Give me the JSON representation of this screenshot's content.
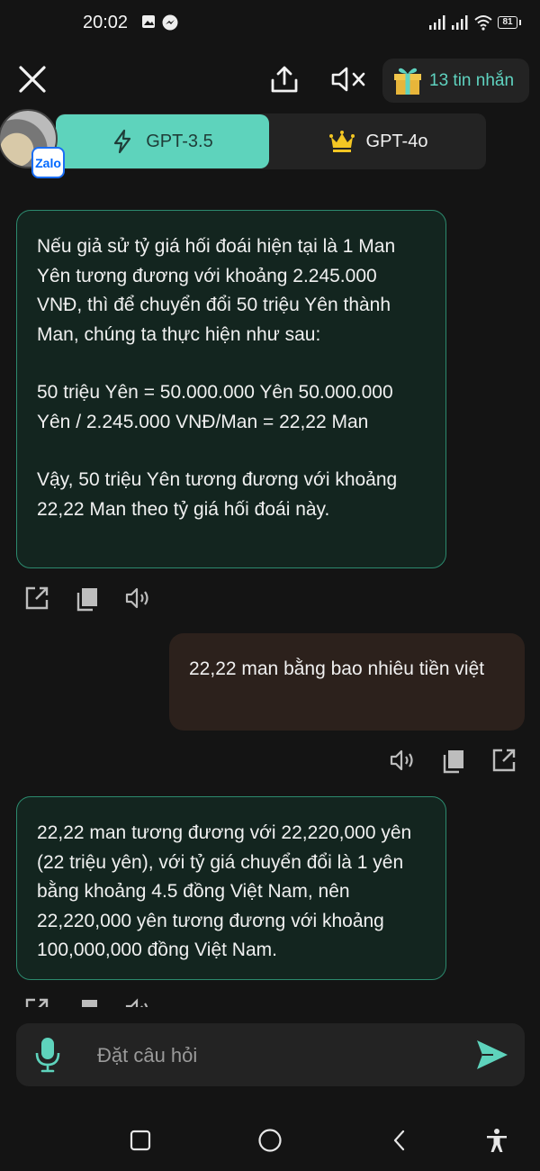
{
  "status_bar": {
    "time": "20:02",
    "battery": "81",
    "icons": [
      "gallery-icon",
      "messenger-icon",
      "signal-icon",
      "signal-icon",
      "wifi-icon",
      "battery-icon"
    ]
  },
  "top_bar": {
    "close_icon": "close-icon",
    "share_icon": "share-icon",
    "mute_icon": "volume-mute-icon",
    "gift_icon": "gift-icon",
    "gift_label": "13 tin nhắn"
  },
  "model_tabs": [
    {
      "label": "GPT-3.5",
      "icon": "lightning-icon",
      "selected": true
    },
    {
      "label": "GPT-4o",
      "icon": "crown-icon",
      "selected": false
    }
  ],
  "avatar": {
    "badge": "Zalo"
  },
  "messages": [
    {
      "role": "bot",
      "paragraphs": [
        "Nếu giả sử tỷ giá hối đoái hiện tại là 1 Man Yên tương đương với khoảng 2.245.000 VNĐ, thì để chuyển đổi 50 triệu Yên thành Man, chúng ta thực hiện như sau:",
        "50 triệu Yên = 50.000.000 Yên 50.000.000 Yên / 2.245.000 VNĐ/Man = 22,22 Man",
        "Vậy, 50 triệu Yên tương đương với khoảng 22,22 Man theo tỷ giá hối đoái này."
      ]
    },
    {
      "role": "user",
      "text": "22,22 man bằng bao nhiêu tiền việt"
    },
    {
      "role": "bot",
      "paragraphs": [
        "22,22 man tương đương với 22,220,000 yên (22 triệu yên), với tỷ giá chuyển đổi là 1 yên bằng khoảng 4.5 đồng Việt Nam, nên 22,220,000 yên tương đương với khoảng 100,000,000 đồng Việt Nam."
      ]
    }
  ],
  "message_actions": [
    "open-external-icon",
    "copy-icon",
    "speaker-icon"
  ],
  "composer": {
    "mic_icon": "microphone-icon",
    "placeholder": "Đặt câu hỏi",
    "send_icon": "send-icon"
  },
  "nav_bar": [
    "recents-icon",
    "home-icon",
    "back-icon",
    "accessibility-icon"
  ],
  "colors": {
    "accent": "#5ed3bc",
    "background": "#141414",
    "bot_bubble": "#13251f",
    "bot_border": "#2c8a6e",
    "user_bubble": "#2c211c",
    "gold": "#f3c623"
  }
}
